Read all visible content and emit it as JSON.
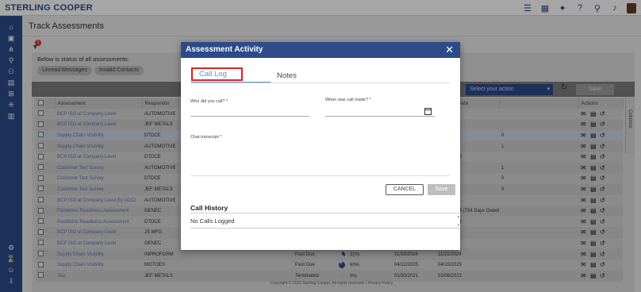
{
  "app": {
    "brand": "STERLING COOPER"
  },
  "page": {
    "title": "Track Assessments",
    "status_line": "Below is status of all assessments.",
    "chips": [
      "Unread Messages",
      "Invalid Contacts"
    ],
    "filter_badge": "1",
    "select_action": "Select your action",
    "save_label": "Save",
    "columns_tab": "Columns",
    "footer": "Copyright © 2025 Sterling Cooper. All rights reserved. | Privacy Policy"
  },
  "grid": {
    "headers": [
      "",
      "Assessment",
      "Respondin",
      "",
      "",
      "",
      "Commit Date",
      "",
      "Actions"
    ],
    "rows": [
      {
        "assessment": "BCP ISO at Company Level",
        "respondent": "AUTOMOTIVE",
        "status": "",
        "pct": "",
        "d1": "",
        "d2": "",
        "flag": ""
      },
      {
        "assessment": "BCP ISO at Company Level",
        "respondent": "JEF METALS",
        "status": "",
        "pct": "",
        "d1": "",
        "d2": "",
        "flag": ""
      },
      {
        "assessment": "Supply Chain Visibility",
        "respondent": "DTDCE",
        "status": "",
        "pct": "",
        "d1": "",
        "d2": "",
        "flag": "0"
      },
      {
        "assessment": "Supply Chain Visibility",
        "respondent": "AUTOMOTIVE",
        "status": "",
        "pct": "",
        "d1": "",
        "d2": "",
        "flag": "1"
      },
      {
        "assessment": "BCP ISO at Company Level",
        "respondent": "DTDCE",
        "status": "",
        "pct": "",
        "d1": "",
        "d2": "12/30/2023",
        "flag": ""
      },
      {
        "assessment": "Customer Test Survey",
        "respondent": "AUTOMOTIVE",
        "status": "",
        "pct": "",
        "d1": "",
        "d2": "",
        "flag": "1"
      },
      {
        "assessment": "Customer Test Survey",
        "respondent": "DTDCE",
        "status": "",
        "pct": "",
        "d1": "",
        "d2": "",
        "flag": "0"
      },
      {
        "assessment": "Customer Test Survey",
        "respondent": "JEF METALS",
        "status": "",
        "pct": "",
        "d1": "",
        "d2": "",
        "flag": "0"
      },
      {
        "assessment": "BCP ISO at Company Level By AD12",
        "respondent": "AUTOMOTIVE",
        "status": "",
        "pct": "",
        "d1": "",
        "d2": "",
        "flag": ""
      },
      {
        "assessment": "Pandemic Readiness Assessment",
        "respondent": "GENEC",
        "status": "",
        "pct": "",
        "d1": "",
        "d2": "03/25/2024 (724 Days Overdue)",
        "flag": ""
      },
      {
        "assessment": "Pandemic Readiness Assessment",
        "respondent": "DTDCE",
        "status": "",
        "pct": "",
        "d1": "",
        "d2": "08/05/2022",
        "flag": ""
      },
      {
        "assessment": "BCP ISO at Company Level",
        "respondent": "JS MFG",
        "status": "",
        "pct": "",
        "d1": "",
        "d2": "",
        "flag": ""
      },
      {
        "assessment": "BCP ISO at Company Level",
        "respondent": "GENEC",
        "status": "",
        "pct": "",
        "d1": "",
        "d2": "",
        "flag": ""
      },
      {
        "assessment": "Supply Chain Visibility",
        "respondent": "INPROFORM",
        "status": "Past Due",
        "pct": "32%",
        "d1": "11/19/2024",
        "d2": "11/21/2024",
        "flag": ""
      },
      {
        "assessment": "Supply Chain Visibility",
        "respondent": "MOTOES",
        "status": "Past Due",
        "pct": "90%",
        "d1": "04/12/2025",
        "d2": "04/15/2025",
        "flag": ""
      },
      {
        "assessment": "Test",
        "respondent": "JEF METALS",
        "status": "Terminated",
        "pct": "0%",
        "d1": "01/30/2021",
        "d2": "02/06/2021",
        "flag": ""
      }
    ]
  },
  "modal": {
    "title": "Assessment Activity",
    "tabs": [
      "Call Log",
      "Notes"
    ],
    "who_label": "Who did you call? *",
    "when_label": "When was call made? *",
    "transcript_label": "Chat transcript *",
    "cancel_label": "CANCEL",
    "save_label": "Save",
    "history_title": "Call History",
    "history_empty": "No Calls Logged"
  },
  "colors": {
    "brand": "#2d4a8a",
    "highlight_box": "#dd2222",
    "tab_active": "#5b8fd9"
  }
}
